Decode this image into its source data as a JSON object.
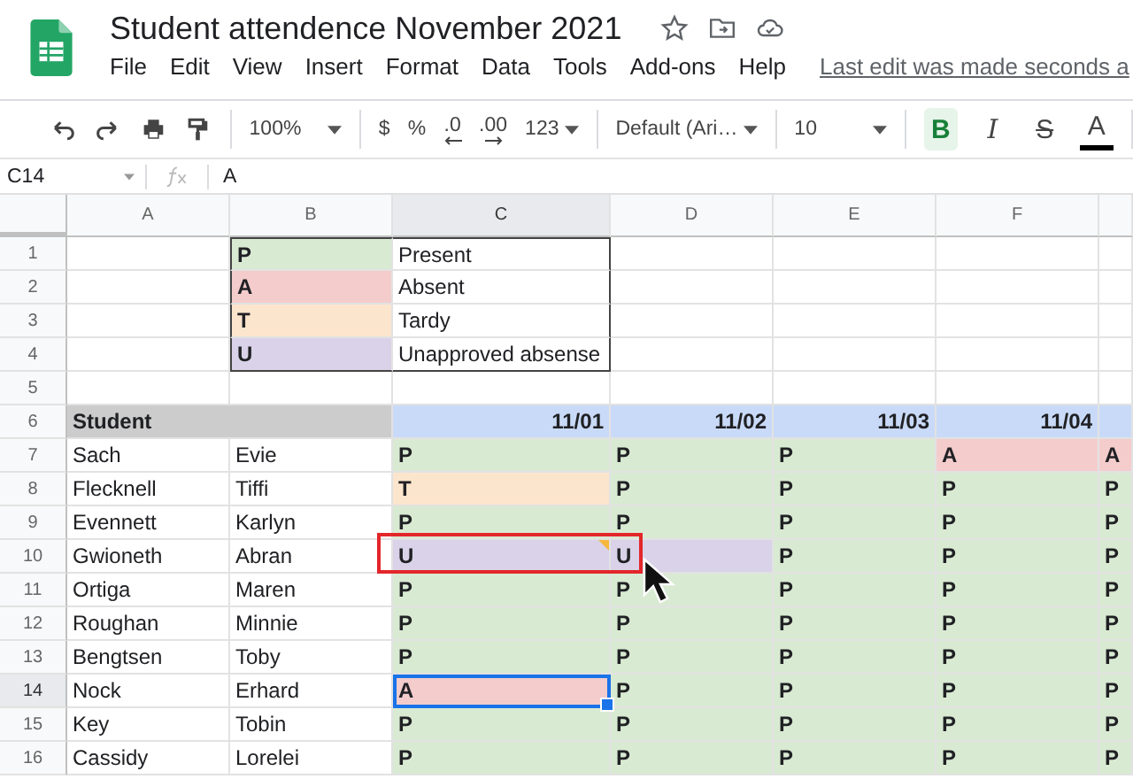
{
  "title": "Student attendence November 2021",
  "menu": [
    "File",
    "Edit",
    "View",
    "Insert",
    "Format",
    "Data",
    "Tools",
    "Add-ons",
    "Help"
  ],
  "last_edit": "Last edit was made seconds a",
  "toolbar": {
    "zoom": "100%",
    "currency": "$",
    "percent": "%",
    "decimal_less": ".0",
    "decimal_more": ".00",
    "number_format": "123",
    "font": "Default (Ari…",
    "font_size": "10",
    "format_buttons": [
      {
        "label": "B",
        "kind": "bold",
        "on": true
      },
      {
        "label": "I",
        "kind": "italic",
        "on": false
      },
      {
        "label": "S",
        "kind": "strike",
        "on": false
      },
      {
        "label": "A",
        "kind": "color",
        "on": false
      }
    ]
  },
  "formula_bar": {
    "cell": "C14",
    "value": "A"
  },
  "columns": [
    {
      "label": "A",
      "selected": false
    },
    {
      "label": "B",
      "selected": false
    },
    {
      "label": "C",
      "selected": true
    },
    {
      "label": "D",
      "selected": false
    },
    {
      "label": "E",
      "selected": false
    },
    {
      "label": "F",
      "selected": false
    }
  ],
  "legend": [
    {
      "row": "1",
      "code": "P",
      "color": "#d9ead3",
      "meaning": "Present"
    },
    {
      "row": "2",
      "code": "A",
      "color": "#f4cccc",
      "meaning": "Absent"
    },
    {
      "row": "3",
      "code": "T",
      "color": "#fce5cd",
      "meaning": "Tardy"
    },
    {
      "row": "4",
      "code": "U",
      "color": "#d9d2e9",
      "meaning": "Unapproved absense"
    }
  ],
  "empty_row": "5",
  "header_row": {
    "row": "6",
    "label": "Student",
    "dates": [
      "11/01",
      "11/02",
      "11/03",
      "11/04"
    ]
  },
  "students": [
    {
      "row": "7",
      "selected": false,
      "last": "Sach",
      "first": "Evie",
      "marks": [
        {
          "value": "P",
          "color": "#d9ead3",
          "selected": false,
          "note": false
        },
        {
          "value": "P",
          "color": "#d9ead3",
          "selected": false,
          "note": false
        },
        {
          "value": "P",
          "color": "#d9ead3",
          "selected": false,
          "note": false
        },
        {
          "value": "A",
          "color": "#f4cccc",
          "selected": false,
          "note": false
        },
        {
          "value": "A",
          "color": "#f4cccc",
          "selected": false,
          "note": false
        }
      ]
    },
    {
      "row": "8",
      "selected": false,
      "last": "Flecknell",
      "first": "Tiffi",
      "marks": [
        {
          "value": "T",
          "color": "#fce5cd",
          "selected": false,
          "note": false
        },
        {
          "value": "P",
          "color": "#d9ead3",
          "selected": false,
          "note": false
        },
        {
          "value": "P",
          "color": "#d9ead3",
          "selected": false,
          "note": false
        },
        {
          "value": "P",
          "color": "#d9ead3",
          "selected": false,
          "note": false
        },
        {
          "value": "P",
          "color": "#d9ead3",
          "selected": false,
          "note": false
        }
      ]
    },
    {
      "row": "9",
      "selected": false,
      "last": "Evennett",
      "first": "Karlyn",
      "marks": [
        {
          "value": "P",
          "color": "#d9ead3",
          "selected": false,
          "note": false
        },
        {
          "value": "P",
          "color": "#d9ead3",
          "selected": false,
          "note": false
        },
        {
          "value": "P",
          "color": "#d9ead3",
          "selected": false,
          "note": false
        },
        {
          "value": "P",
          "color": "#d9ead3",
          "selected": false,
          "note": false
        },
        {
          "value": "P",
          "color": "#d9ead3",
          "selected": false,
          "note": false
        }
      ]
    },
    {
      "row": "10",
      "selected": false,
      "last": "Gwioneth",
      "first": "Abran",
      "marks": [
        {
          "value": "U",
          "color": "#d9d2e9",
          "selected": false,
          "note": true
        },
        {
          "value": "U",
          "color": "#d9d2e9",
          "selected": false,
          "note": false
        },
        {
          "value": "P",
          "color": "#d9ead3",
          "selected": false,
          "note": false
        },
        {
          "value": "P",
          "color": "#d9ead3",
          "selected": false,
          "note": false
        },
        {
          "value": "P",
          "color": "#d9ead3",
          "selected": false,
          "note": false
        }
      ]
    },
    {
      "row": "11",
      "selected": false,
      "last": "Ortiga",
      "first": "Maren",
      "marks": [
        {
          "value": "P",
          "color": "#d9ead3",
          "selected": false,
          "note": false
        },
        {
          "value": "P",
          "color": "#d9ead3",
          "selected": false,
          "note": false
        },
        {
          "value": "P",
          "color": "#d9ead3",
          "selected": false,
          "note": false
        },
        {
          "value": "P",
          "color": "#d9ead3",
          "selected": false,
          "note": false
        },
        {
          "value": "P",
          "color": "#d9ead3",
          "selected": false,
          "note": false
        }
      ]
    },
    {
      "row": "12",
      "selected": false,
      "last": "Roughan",
      "first": "Minnie",
      "marks": [
        {
          "value": "P",
          "color": "#d9ead3",
          "selected": false,
          "note": false
        },
        {
          "value": "P",
          "color": "#d9ead3",
          "selected": false,
          "note": false
        },
        {
          "value": "P",
          "color": "#d9ead3",
          "selected": false,
          "note": false
        },
        {
          "value": "P",
          "color": "#d9ead3",
          "selected": false,
          "note": false
        },
        {
          "value": "P",
          "color": "#d9ead3",
          "selected": false,
          "note": false
        }
      ]
    },
    {
      "row": "13",
      "selected": false,
      "last": "Bengtsen",
      "first": "Toby",
      "marks": [
        {
          "value": "P",
          "color": "#d9ead3",
          "selected": false,
          "note": false
        },
        {
          "value": "P",
          "color": "#d9ead3",
          "selected": false,
          "note": false
        },
        {
          "value": "P",
          "color": "#d9ead3",
          "selected": false,
          "note": false
        },
        {
          "value": "P",
          "color": "#d9ead3",
          "selected": false,
          "note": false
        },
        {
          "value": "P",
          "color": "#d9ead3",
          "selected": false,
          "note": false
        }
      ]
    },
    {
      "row": "14",
      "selected": true,
      "last": "Nock",
      "first": "Erhard",
      "marks": [
        {
          "value": "A",
          "color": "#f4cccc",
          "selected": true,
          "note": false
        },
        {
          "value": "P",
          "color": "#d9ead3",
          "selected": false,
          "note": false
        },
        {
          "value": "P",
          "color": "#d9ead3",
          "selected": false,
          "note": false
        },
        {
          "value": "P",
          "color": "#d9ead3",
          "selected": false,
          "note": false
        },
        {
          "value": "P",
          "color": "#d9ead3",
          "selected": false,
          "note": false
        }
      ]
    },
    {
      "row": "15",
      "selected": false,
      "last": "Key",
      "first": "Tobin",
      "marks": [
        {
          "value": "P",
          "color": "#d9ead3",
          "selected": false,
          "note": false
        },
        {
          "value": "P",
          "color": "#d9ead3",
          "selected": false,
          "note": false
        },
        {
          "value": "P",
          "color": "#d9ead3",
          "selected": false,
          "note": false
        },
        {
          "value": "P",
          "color": "#d9ead3",
          "selected": false,
          "note": false
        },
        {
          "value": "P",
          "color": "#d9ead3",
          "selected": false,
          "note": false
        }
      ]
    },
    {
      "row": "16",
      "selected": false,
      "last": "Cassidy",
      "first": "Lorelei",
      "marks": [
        {
          "value": "P",
          "color": "#d9ead3",
          "selected": false,
          "note": false
        },
        {
          "value": "P",
          "color": "#d9ead3",
          "selected": false,
          "note": false
        },
        {
          "value": "P",
          "color": "#d9ead3",
          "selected": false,
          "note": false
        },
        {
          "value": "P",
          "color": "#d9ead3",
          "selected": false,
          "note": false
        },
        {
          "value": "P",
          "color": "#d9ead3",
          "selected": false,
          "note": false
        }
      ]
    }
  ]
}
